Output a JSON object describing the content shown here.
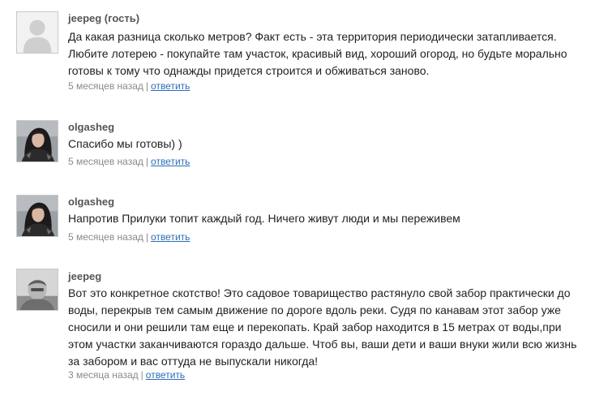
{
  "comments": [
    {
      "author": "jeepeg (гость)",
      "avatar_icon": "default-user-icon",
      "lines": [
        "Да какая разница сколько метров? Факт есть - эта территория периодически затапливается.",
        "Любите лотерею - покупайте там участок, красивый вид, хороший огород, но будьте морально",
        "готовы к тому что однажды придется строится и обживаться заново."
      ],
      "time": "5 месяцев назад",
      "separator": "|",
      "reply_label": "ответить"
    },
    {
      "author": "olgasheg",
      "avatar_icon": "user-photo-icon",
      "lines": [
        "Спасибо мы готовы) )"
      ],
      "time": "5 месяцев назад",
      "separator": "|",
      "reply_label": "ответить"
    },
    {
      "author": "olgasheg",
      "avatar_icon": "user-photo-icon",
      "lines": [
        "Напротив Прилуки топит каждый год. Ничего живут люди и мы переживем"
      ],
      "time": "5 месяцев назад",
      "separator": "|",
      "reply_label": "ответить"
    },
    {
      "author": "jeepeg",
      "avatar_icon": "user-photo-icon",
      "lines": [
        "Вот это конкретное скотство! Это садовое товарищество растянуло свой забор практически до",
        "воды, перекрыв тем самым движение по дороге вдоль реки. Судя по канавам этот забор уже",
        "сносили и они решили там еще и перекопать. Край забор находится в 15 метрах от воды,при",
        "этом участки заканчиваются гораздо дальше. Чтоб вы, ваши дети и ваши внуки жили всю жизнь",
        "за забором и вас оттуда не выпускали никогда!"
      ],
      "time": "3 месяца назад",
      "separator": "|",
      "reply_label": "ответить"
    }
  ],
  "colors": {
    "author": "#555555",
    "text": "#1f1f1f",
    "meta": "#8a8a8a",
    "link": "#2a6db8",
    "avatar_border": "#c8c8c8"
  }
}
